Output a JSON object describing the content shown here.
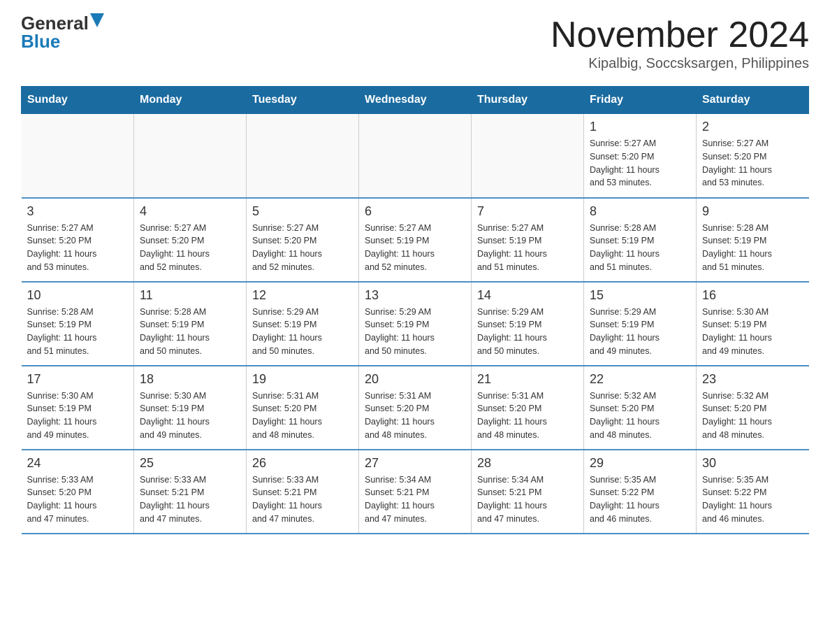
{
  "header": {
    "logo_general": "General",
    "logo_blue": "Blue",
    "month_title": "November 2024",
    "location": "Kipalbig, Soccsksargen, Philippines"
  },
  "days_of_week": [
    "Sunday",
    "Monday",
    "Tuesday",
    "Wednesday",
    "Thursday",
    "Friday",
    "Saturday"
  ],
  "weeks": [
    [
      {
        "day": "",
        "info": "",
        "empty": true
      },
      {
        "day": "",
        "info": "",
        "empty": true
      },
      {
        "day": "",
        "info": "",
        "empty": true
      },
      {
        "day": "",
        "info": "",
        "empty": true
      },
      {
        "day": "",
        "info": "",
        "empty": true
      },
      {
        "day": "1",
        "info": "Sunrise: 5:27 AM\nSunset: 5:20 PM\nDaylight: 11 hours\nand 53 minutes."
      },
      {
        "day": "2",
        "info": "Sunrise: 5:27 AM\nSunset: 5:20 PM\nDaylight: 11 hours\nand 53 minutes."
      }
    ],
    [
      {
        "day": "3",
        "info": "Sunrise: 5:27 AM\nSunset: 5:20 PM\nDaylight: 11 hours\nand 53 minutes."
      },
      {
        "day": "4",
        "info": "Sunrise: 5:27 AM\nSunset: 5:20 PM\nDaylight: 11 hours\nand 52 minutes."
      },
      {
        "day": "5",
        "info": "Sunrise: 5:27 AM\nSunset: 5:20 PM\nDaylight: 11 hours\nand 52 minutes."
      },
      {
        "day": "6",
        "info": "Sunrise: 5:27 AM\nSunset: 5:19 PM\nDaylight: 11 hours\nand 52 minutes."
      },
      {
        "day": "7",
        "info": "Sunrise: 5:27 AM\nSunset: 5:19 PM\nDaylight: 11 hours\nand 51 minutes."
      },
      {
        "day": "8",
        "info": "Sunrise: 5:28 AM\nSunset: 5:19 PM\nDaylight: 11 hours\nand 51 minutes."
      },
      {
        "day": "9",
        "info": "Sunrise: 5:28 AM\nSunset: 5:19 PM\nDaylight: 11 hours\nand 51 minutes."
      }
    ],
    [
      {
        "day": "10",
        "info": "Sunrise: 5:28 AM\nSunset: 5:19 PM\nDaylight: 11 hours\nand 51 minutes."
      },
      {
        "day": "11",
        "info": "Sunrise: 5:28 AM\nSunset: 5:19 PM\nDaylight: 11 hours\nand 50 minutes."
      },
      {
        "day": "12",
        "info": "Sunrise: 5:29 AM\nSunset: 5:19 PM\nDaylight: 11 hours\nand 50 minutes."
      },
      {
        "day": "13",
        "info": "Sunrise: 5:29 AM\nSunset: 5:19 PM\nDaylight: 11 hours\nand 50 minutes."
      },
      {
        "day": "14",
        "info": "Sunrise: 5:29 AM\nSunset: 5:19 PM\nDaylight: 11 hours\nand 50 minutes."
      },
      {
        "day": "15",
        "info": "Sunrise: 5:29 AM\nSunset: 5:19 PM\nDaylight: 11 hours\nand 49 minutes."
      },
      {
        "day": "16",
        "info": "Sunrise: 5:30 AM\nSunset: 5:19 PM\nDaylight: 11 hours\nand 49 minutes."
      }
    ],
    [
      {
        "day": "17",
        "info": "Sunrise: 5:30 AM\nSunset: 5:19 PM\nDaylight: 11 hours\nand 49 minutes."
      },
      {
        "day": "18",
        "info": "Sunrise: 5:30 AM\nSunset: 5:19 PM\nDaylight: 11 hours\nand 49 minutes."
      },
      {
        "day": "19",
        "info": "Sunrise: 5:31 AM\nSunset: 5:20 PM\nDaylight: 11 hours\nand 48 minutes."
      },
      {
        "day": "20",
        "info": "Sunrise: 5:31 AM\nSunset: 5:20 PM\nDaylight: 11 hours\nand 48 minutes."
      },
      {
        "day": "21",
        "info": "Sunrise: 5:31 AM\nSunset: 5:20 PM\nDaylight: 11 hours\nand 48 minutes."
      },
      {
        "day": "22",
        "info": "Sunrise: 5:32 AM\nSunset: 5:20 PM\nDaylight: 11 hours\nand 48 minutes."
      },
      {
        "day": "23",
        "info": "Sunrise: 5:32 AM\nSunset: 5:20 PM\nDaylight: 11 hours\nand 48 minutes."
      }
    ],
    [
      {
        "day": "24",
        "info": "Sunrise: 5:33 AM\nSunset: 5:20 PM\nDaylight: 11 hours\nand 47 minutes."
      },
      {
        "day": "25",
        "info": "Sunrise: 5:33 AM\nSunset: 5:21 PM\nDaylight: 11 hours\nand 47 minutes."
      },
      {
        "day": "26",
        "info": "Sunrise: 5:33 AM\nSunset: 5:21 PM\nDaylight: 11 hours\nand 47 minutes."
      },
      {
        "day": "27",
        "info": "Sunrise: 5:34 AM\nSunset: 5:21 PM\nDaylight: 11 hours\nand 47 minutes."
      },
      {
        "day": "28",
        "info": "Sunrise: 5:34 AM\nSunset: 5:21 PM\nDaylight: 11 hours\nand 47 minutes."
      },
      {
        "day": "29",
        "info": "Sunrise: 5:35 AM\nSunset: 5:22 PM\nDaylight: 11 hours\nand 46 minutes."
      },
      {
        "day": "30",
        "info": "Sunrise: 5:35 AM\nSunset: 5:22 PM\nDaylight: 11 hours\nand 46 minutes."
      }
    ]
  ]
}
